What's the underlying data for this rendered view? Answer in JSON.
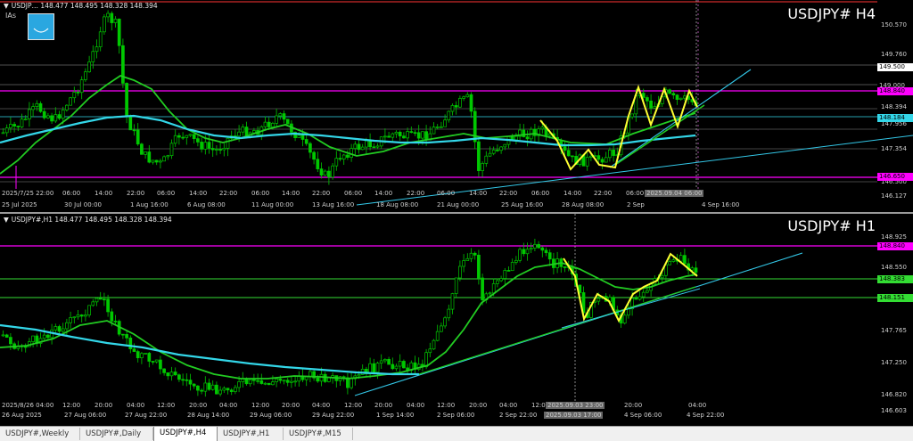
{
  "top_pane": {
    "ohlc": "USDJP… 148.477 148.495 148.328 148.394",
    "symbol_title": "USDJPY# H4",
    "indicator_label": "IAs",
    "price_ticks": [
      "150.570",
      "149.760",
      "148.394",
      "147.956",
      "147.354",
      "146.500",
      "146.127"
    ],
    "price_labels": {
      "p149500": "149.500",
      "p149000": "149.000",
      "magenta_upper": "148.840",
      "p148184": "148.184",
      "magenta_lower": "146.650"
    },
    "crosshair_time": "2025.09.04 06:00",
    "time_labels": [
      "25 Jul 2025",
      "30 Jul 00:00",
      "1 Aug 16:00",
      "6 Aug 08:00",
      "11 Aug 00:00",
      "13 Aug 16:00",
      "18 Aug 08:00",
      "21 Aug 00:00",
      "25 Aug 16:00",
      "28 Aug 08:00",
      "2 Sep",
      "4 Sep 16:00"
    ],
    "hour_labels": [
      "2025/7/25 22:00",
      "06:00",
      "14:00",
      "22:00",
      "06:00",
      "14:00",
      "22:00",
      "06:00",
      "14:00",
      "22:00",
      "06:00",
      "14:00",
      "22:00",
      "06:00",
      "14:00",
      "22:00",
      "06:00",
      "14:00",
      "22:00",
      "06:00"
    ]
  },
  "bottom_pane": {
    "ohlc": "USDJPY#,H1 148.477 148.495 148.328 148.394",
    "symbol_title": "USDJPY# H1",
    "price_ticks": [
      "148.925",
      "148.550",
      "147.765",
      "147.250",
      "146.820",
      "146.603"
    ],
    "price_labels": {
      "magenta": "148.840",
      "green_upper": "148.383",
      "green_lower": "148.151"
    },
    "crosshair_time": "2025.09.03 17:00",
    "crosshair_hour": "2025.09.03 23:00",
    "time_labels": [
      "26 Aug 2025",
      "27 Aug 06:00",
      "27 Aug 22:00",
      "28 Aug 14:00",
      "29 Aug 06:00",
      "29 Aug 22:00",
      "1 Sep 14:00",
      "2 Sep 06:00",
      "2 Sep 22:00",
      "4 Sep 06:00",
      "4 Sep 22:00"
    ],
    "hour_labels": [
      "2025/8/26 04:00",
      "12:00",
      "20:00",
      "04:00",
      "12:00",
      "20:00",
      "04:00",
      "12:00",
      "20:00",
      "04:00",
      "12:00",
      "20:00",
      "04:00",
      "12:00",
      "20:00",
      "04:00",
      "12:00",
      "20:00",
      "04:00"
    ]
  },
  "tabs": [
    {
      "label": "USDJPY#,Weekly",
      "active": false
    },
    {
      "label": "USDJPY#,Daily",
      "active": false
    },
    {
      "label": "USDJPY#,H4",
      "active": true
    },
    {
      "label": "USDJPY#,H1",
      "active": false
    },
    {
      "label": "USDJPY#,M15",
      "active": false
    }
  ],
  "colors": {
    "candle": "#00c800",
    "ma_green": "#22cc22",
    "ma_cyan": "#33d6e8",
    "zigzag": "#ffff33",
    "trendline": "#33c8e8",
    "magenta": "#ff00ff",
    "green_level": "#33dd33",
    "grid_line": "#808080",
    "label_cyan_bg": "#33d6e8",
    "label_magenta_bg": "#ff00ff"
  }
}
